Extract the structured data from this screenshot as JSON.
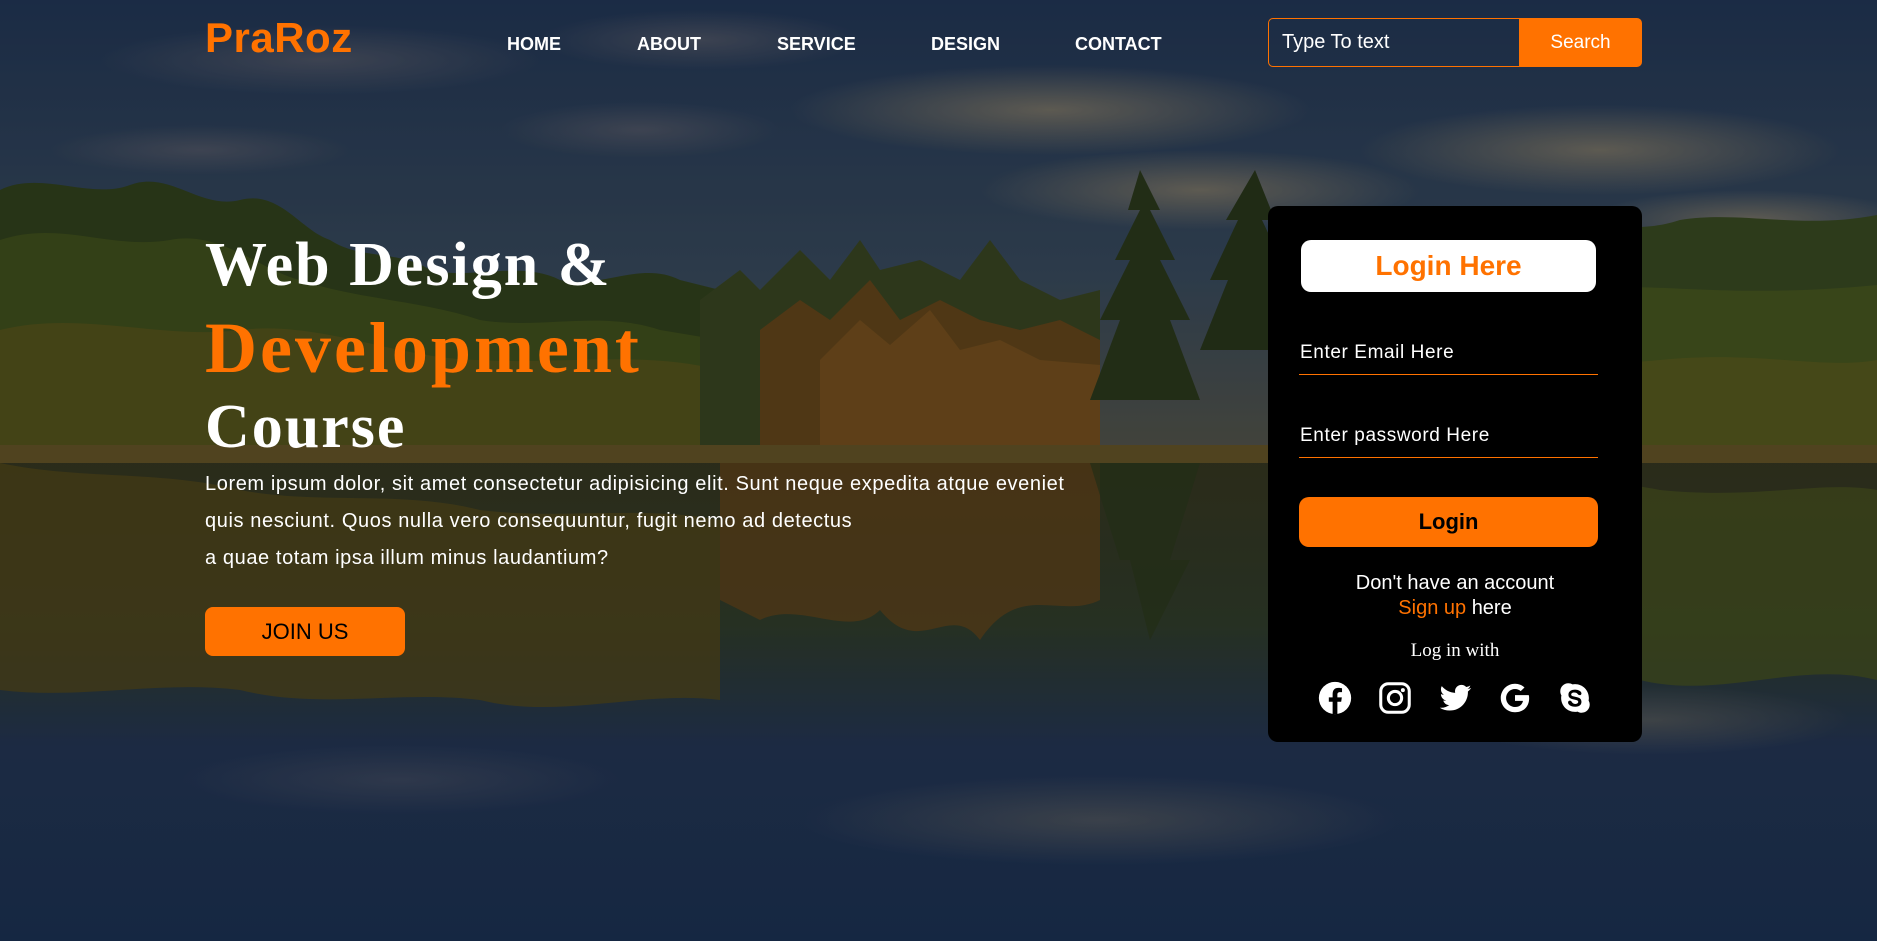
{
  "brand": {
    "logo": "PraRoz"
  },
  "nav": {
    "items": [
      {
        "label": "HOME"
      },
      {
        "label": "ABOUT"
      },
      {
        "label": "SERVICE"
      },
      {
        "label": "DESIGN"
      },
      {
        "label": "CONTACT"
      }
    ]
  },
  "search": {
    "placeholder": "Type To text",
    "button_label": "Search"
  },
  "hero": {
    "line1": "Web Design &",
    "line2": "Development",
    "line3": "Course",
    "paragraph_lines": [
      "Lorem ipsum dolor, sit amet consectetur adipisicing elit. Sunt neque expedita atque eveniet",
      "quis nesciunt. Quos nulla vero consequuntur, fugit nemo ad detectus",
      "a quae totam ipsa illum minus laudantium?"
    ],
    "join_button_label": "JOIN US"
  },
  "login": {
    "title": "Login Here",
    "email_placeholder": "Enter Email Here",
    "password_placeholder": "Enter password Here",
    "button_label": "Login",
    "no_account_text": "Don't have an account",
    "signup_link": "Sign up",
    "signup_suffix": "here",
    "login_with_text": "Log in with",
    "social_icons": [
      "facebook-icon",
      "instagram-icon",
      "twitter-icon",
      "google-icon",
      "skype-icon"
    ]
  },
  "colors": {
    "accent": "#ff7200",
    "card_background": "#000000",
    "text_light": "#ffffff"
  }
}
